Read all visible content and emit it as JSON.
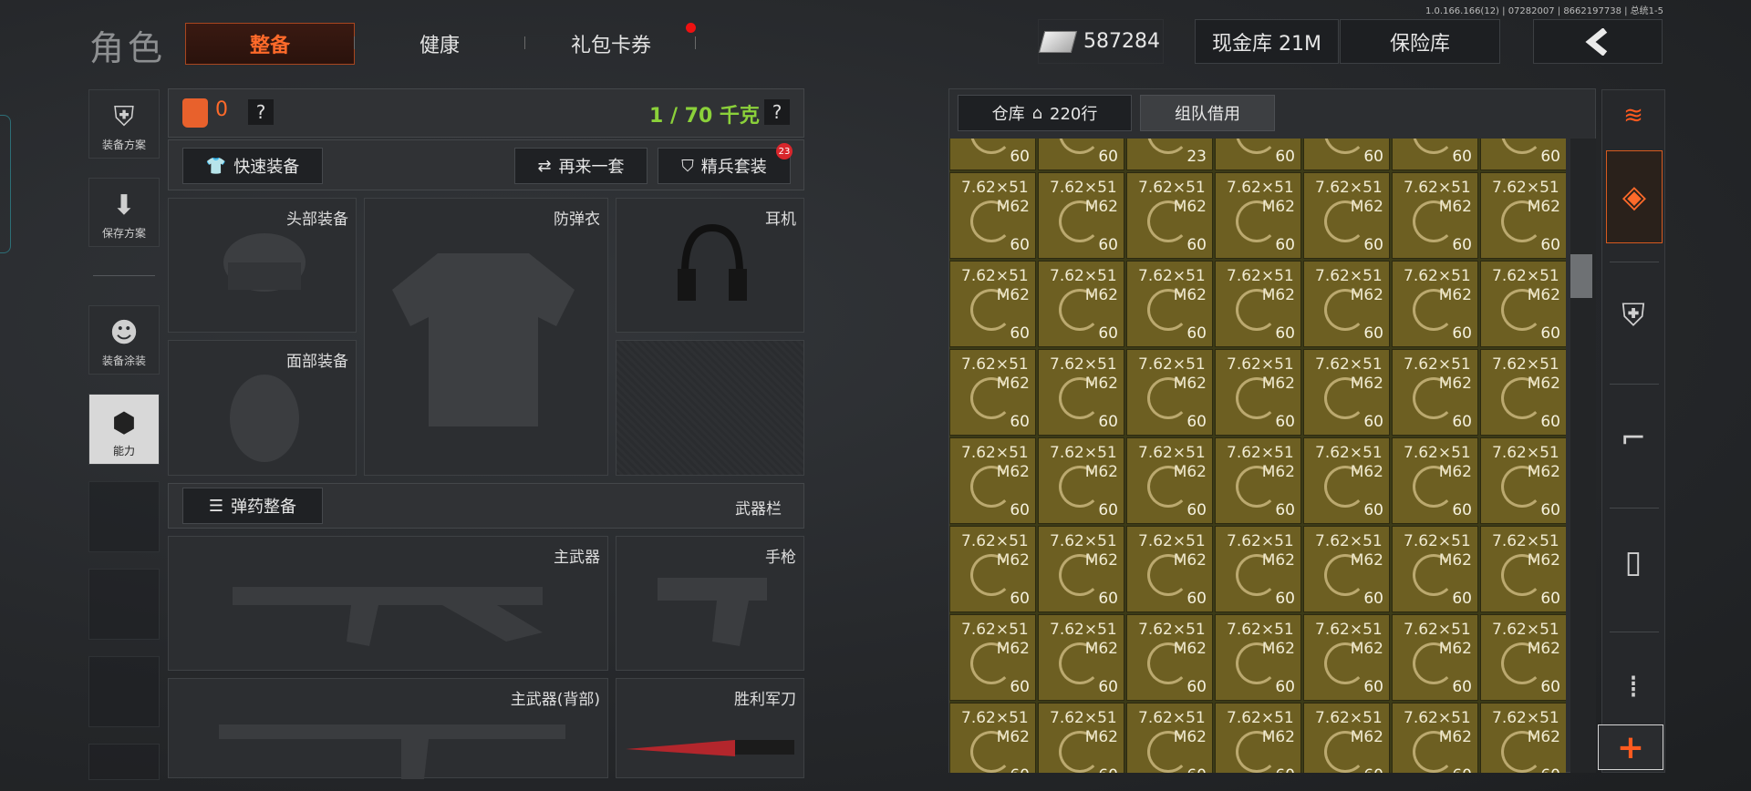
{
  "version": "1.0.166.166(12) | 07282007 | 8662197738 | 总统1-5",
  "page_title": "角色",
  "tabs": {
    "active": "整备",
    "health": "健康",
    "gift": "礼包卡券"
  },
  "currency": {
    "money": "587284",
    "cash_vault": "现金库 21M",
    "safe": "保险库",
    "back_icon": "chevron-left-icon"
  },
  "left_nav": {
    "plan": "装备方案",
    "save": "保存方案",
    "skin": "装备涂装",
    "ability": "能力"
  },
  "loadout": {
    "vest_count": "0",
    "help": "?",
    "weight": "1 / 70 千克",
    "quick_equip": "快速装备",
    "again": "再来一套",
    "elite": "精兵套装",
    "elite_badge": "23"
  },
  "slots": {
    "head": "头部装备",
    "armor": "防弹衣",
    "headset": "耳机",
    "face": "面部装备",
    "ammo_btn": "弹药整备",
    "weapon_bar": "武器栏",
    "primary": "主武器",
    "pistol": "手枪",
    "primary_back": "主武器(背部)",
    "knife": "胜利军刀"
  },
  "warehouse": {
    "tab_storage": "仓库",
    "rows": "220行",
    "tab_team": "组队借用",
    "top_row_counts": [
      "60",
      "60",
      "23",
      "60",
      "60",
      "60",
      "60"
    ],
    "item": {
      "caliber": "7.62×51",
      "model": "M62",
      "count": "60"
    }
  },
  "colors": {
    "accent": "#ff6a2a",
    "weight_green": "#8bd13a",
    "ammo_cell": "#6d5f22"
  }
}
